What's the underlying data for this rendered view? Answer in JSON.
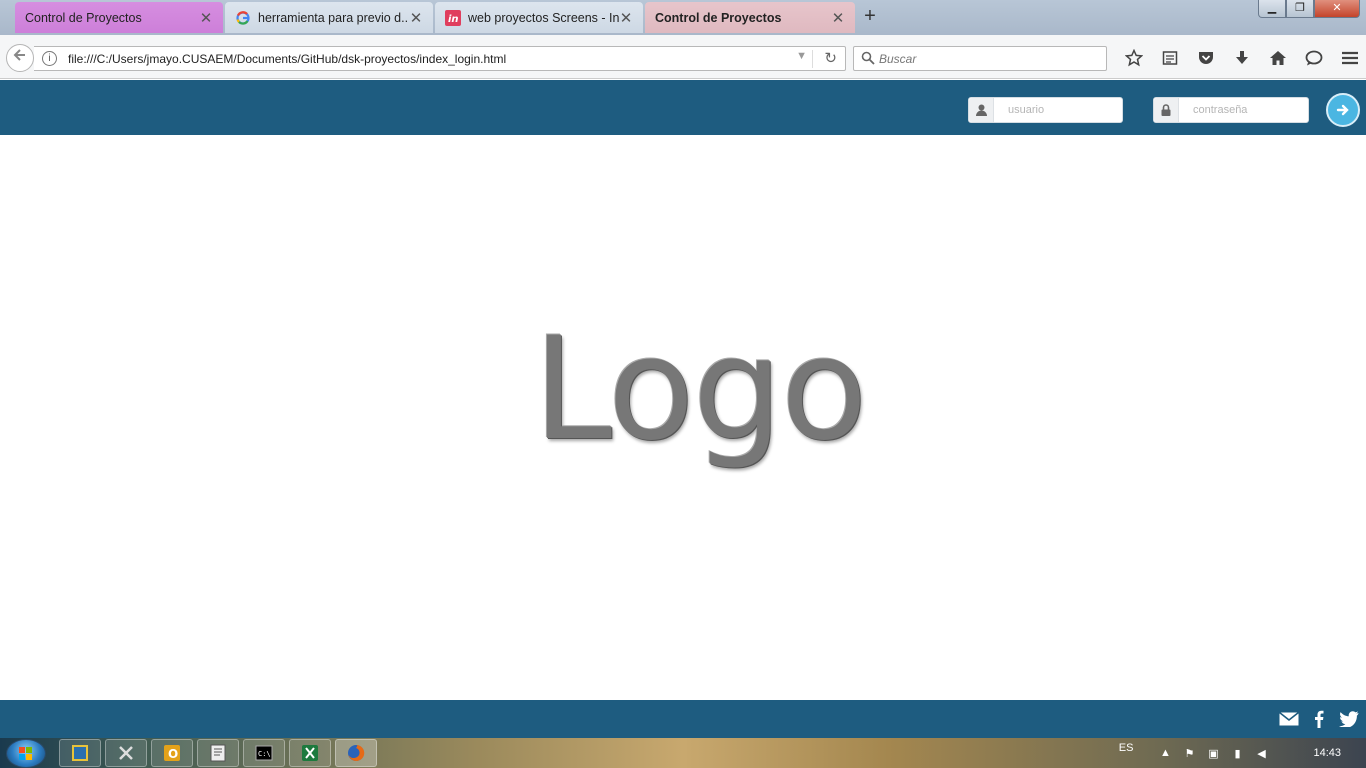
{
  "browser": {
    "tabs": [
      {
        "label": "Control de Proyectos",
        "active": false
      },
      {
        "label": "herramienta para previo d...",
        "active": false
      },
      {
        "label": "web proyectos Screens - In...",
        "active": false
      },
      {
        "label": "Control de Proyectos",
        "active": true
      }
    ],
    "new_tab_label": "+",
    "url": "file:///C:/Users/jmayo.CUSAEM/Documents/GitHub/dsk-proyectos/index_login.html",
    "search_placeholder": "Buscar",
    "toolbar_icons": [
      "bookmark-star-icon",
      "reading-list-icon",
      "pocket-icon",
      "download-icon",
      "home-icon",
      "chat-icon",
      "menu-icon"
    ]
  },
  "header": {
    "username_placeholder": "usuario",
    "password_placeholder": "contraseña",
    "accent_color": "#1e5c80",
    "login_button_color": "#4bb6e2"
  },
  "main": {
    "logo_text": "Logo"
  },
  "footer": {
    "social_icons": [
      "email-icon",
      "facebook-icon",
      "twitter-icon"
    ]
  },
  "taskbar": {
    "language": "ES",
    "time": "14:43"
  }
}
